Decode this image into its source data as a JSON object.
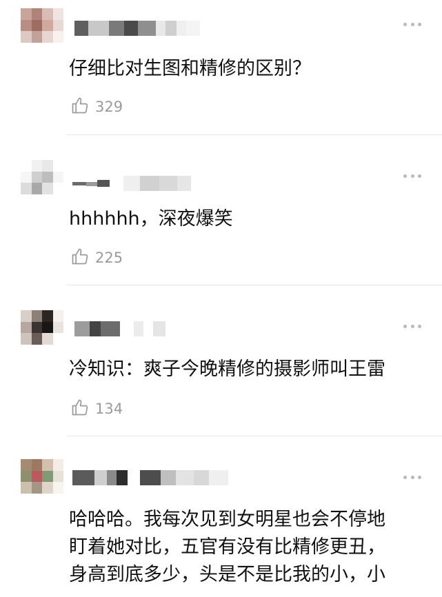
{
  "comments": [
    {
      "text": "仔细比对生图和精修的区别？",
      "likes": "329"
    },
    {
      "text": "hhhhhh，深夜爆笑",
      "likes": "225"
    },
    {
      "text": "冷知识：爽子今晚精修的摄影师叫王雷",
      "likes": "134"
    },
    {
      "text_lines": [
        "哈哈哈。我每次见到女明星也会不停地",
        "盯着她对比，五官有没有比精修更丑，",
        "身高到底多少，头是不是比我的小，小"
      ]
    }
  ],
  "icons": {
    "like": "thumbs-up-icon",
    "more": "more-dots-icon"
  }
}
